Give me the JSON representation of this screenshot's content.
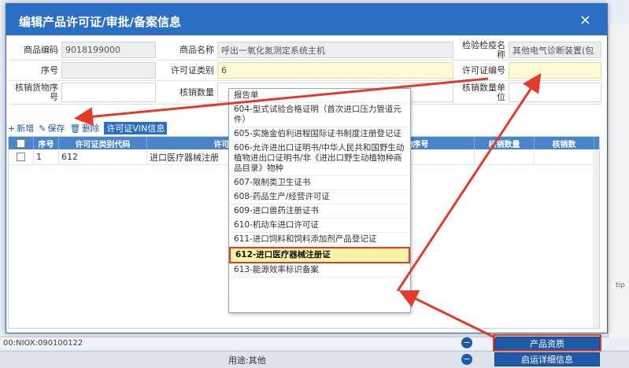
{
  "background": {
    "status_text": "00:NIOX:090100122",
    "use_label": "用途:其他",
    "tip_label": "tip",
    "product_info_button": "产品资质",
    "apply_info_button": "启运详细信息"
  },
  "dialog": {
    "title": "编辑产品许可证/审批/备案信息",
    "close_label": "×"
  },
  "form": {
    "row1": {
      "product_code_label": "商品编码",
      "product_code_value": "9018199000",
      "product_name_label": "商品名称",
      "product_name_value": "呼出一氧化氮测定系统主机",
      "inspection_name_label": "检验检疫名称",
      "inspection_name_value": "其他电气诊断装置(包"
    },
    "row2": {
      "seq_label": "序号",
      "seq_value": "",
      "license_type_label": "许可证类别",
      "license_type_value": "6",
      "license_no_label": "许可证编号",
      "license_no_value": ""
    },
    "row3": {
      "writeoff_seq_label": "核销货物序号",
      "writeoff_qty_label": "核销数量",
      "writeoff_unit_label": "核销数量单位"
    }
  },
  "toolbar": {
    "add": "新增",
    "save": "保存",
    "delete": "删除",
    "vin": "许可证VIN信息"
  },
  "grid": {
    "columns": [
      "",
      "序号",
      "许可证类别代码",
      "许可证类别名称",
      "核销货物序号",
      "核销数量",
      "核销数"
    ],
    "rows": [
      {
        "seq": "1",
        "code": "612",
        "name": "进口医疗器械注册"
      }
    ]
  },
  "dropdown": {
    "items": [
      "报告单",
      "604-型式试验合格证明（首次进口压力管道元件）",
      "605-实施金伯利进程国际证书制度注册登记证",
      "606-允许进出口证明书/中华人民共和国野生动植物进出口证明书/非《进出口野生动植物种商品目录》物种",
      "607-限制类卫生证书",
      "608-药品生产/经营许可证",
      "609-进口兽药注册证书",
      "610-机动车进口许可证",
      "611-进口饲料和饲料添加剂产品登记证",
      "612-进口医疗器械注册证",
      "613-能源效率标识备案"
    ],
    "selected_index": 9
  },
  "colors": {
    "header_blue": "#2a6fc4",
    "annotation_red": "#e53a2a",
    "highlight_yellow": "#f7f4a6"
  }
}
